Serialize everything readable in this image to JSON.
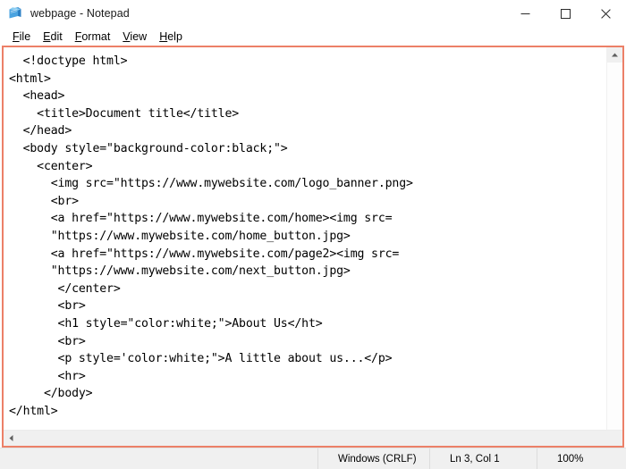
{
  "window": {
    "title": "webpage - Notepad",
    "icon": "notepad-icon",
    "controls": {
      "minimize": "minimize-icon",
      "maximize": "maximize-icon",
      "close": "close-icon"
    }
  },
  "menubar": {
    "items": [
      {
        "label": "File",
        "accesskey": "F",
        "rest": "ile"
      },
      {
        "label": "Edit",
        "accesskey": "E",
        "rest": "dit"
      },
      {
        "label": "Format",
        "accesskey": "F",
        "rest": "ormat"
      },
      {
        "label": "View",
        "accesskey": "V",
        "rest": "iew"
      },
      {
        "label": "Help",
        "accesskey": "H",
        "rest": "elp"
      }
    ]
  },
  "editor": {
    "content": "  <!doctype html>\n<html>\n  <head>\n    <title>Document title</title>\n  </head>\n  <body style=\"background-color:black;\">\n    <center>\n      <img src=\"https://www.mywebsite.com/logo_banner.png>\n      <br>\n      <a href=\"https://www.mywebsite.com/home><img src=\n      \"https://www.mywebsite.com/home_button.jpg>\n      <a href=\"https://www.mywebsite.com/page2><img src=\n      \"https://www.mywebsite.com/next_button.jpg>\n       </center>\n       <br>\n       <h1 style=\"color:white;\">About Us</ht>\n       <br>\n       <p style='color:white;\">A little about us...</p>\n       <hr>\n     </body>\n</html>",
    "lines": [
      "  <!doctype html>",
      "<html>",
      "  <head>",
      "    <title>Document title</title>",
      "  </head>",
      "  <body style=\"background-color:black;\">",
      "    <center>",
      "      <img src=\"https://www.mywebsite.com/logo_banner.png>",
      "      <br>",
      "      <a href=\"https://www.mywebsite.com/home><img src=",
      "      \"https://www.mywebsite.com/home_button.jpg>",
      "      <a href=\"https://www.mywebsite.com/page2><img src=",
      "      \"https://www.mywebsite.com/next_button.jpg>",
      "       </center>",
      "       <br>",
      "       <h1 style=\"color:white;\">About Us</ht>",
      "       <br>",
      "       <p style='color:white;\">A little about us...</p>",
      "       <hr>",
      "     </body>",
      "</html>"
    ]
  },
  "scrollbars": {
    "vertical_up": "scroll-up-arrow-icon",
    "horizontal_left": "scroll-left-arrow-icon"
  },
  "statusbar": {
    "left": "",
    "encoding": "Windows (CRLF)",
    "position": "Ln 3, Col 1",
    "zoom": "100%"
  },
  "colors": {
    "accent_border": "#ec8068",
    "titlebar_bg": "#ffffff",
    "statusbar_bg": "#f0f0f0",
    "text": "#000000"
  }
}
